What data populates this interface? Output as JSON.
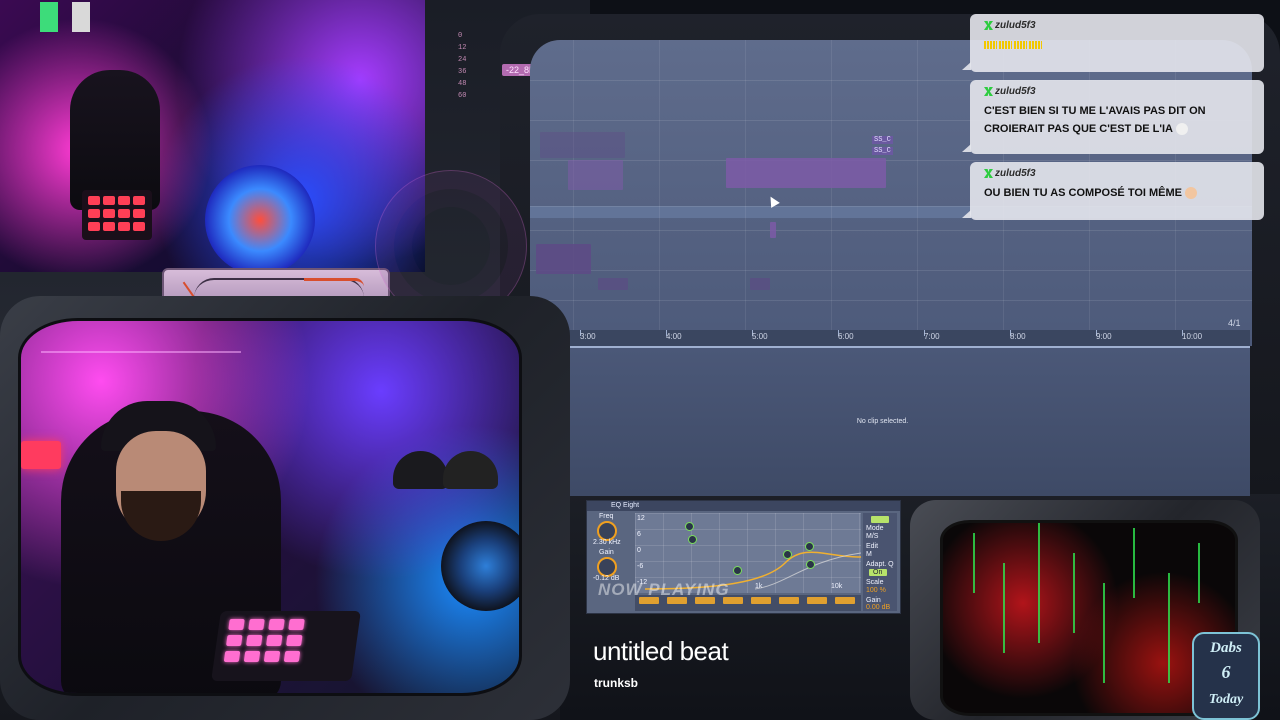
{
  "daw": {
    "loudness_badge": "-22_8LUFS",
    "meter_scale": [
      "0",
      "12",
      "24",
      "36",
      "48",
      "60"
    ],
    "clip_labels": [
      "SS_C",
      "SS_C"
    ],
    "timeline_ticks": [
      "3:00",
      "4:00",
      "5:00",
      "6:00",
      "7:00",
      "8:00",
      "9:00",
      "10:00"
    ],
    "position_label": "4/1",
    "detail_message": "No clip selected."
  },
  "chat": {
    "messages": [
      {
        "user": "zulud5f3",
        "text": ""
      },
      {
        "user": "zulud5f3",
        "text": "C'EST BIEN SI TU ME L'AVAIS PAS DIT ON CROIERAIT PAS QUE C'EST DE L'IA"
      },
      {
        "user": "zulud5f3",
        "text": "OU BIEN TU AS COMPOSÉ TOI MÊME"
      }
    ]
  },
  "eq": {
    "title": "EQ Eight",
    "freq_label": "Freq",
    "freq_value": "2.30 kHz",
    "gain_label": "Gain",
    "gain_value": "-0.12 dB",
    "db_scale": [
      "12",
      "6",
      "0",
      "-6",
      "-12"
    ],
    "mode_label": "Mode",
    "mode_value": "M/S",
    "edit_label": "Edit",
    "edit_value": "M",
    "adapt_label": "Adapt. Q",
    "adapt_value": "On",
    "scale_label": "Scale",
    "scale_value": "100 %",
    "out_gain_label": "Gain",
    "out_gain_value": "0.00 dB",
    "freq_axis": [
      "1k",
      "10k"
    ]
  },
  "now_playing": {
    "label": "NOW PLAYING",
    "title": "untitled beat",
    "artist": "trunksb"
  },
  "logo": {
    "line1": "Dabs",
    "line2": "6",
    "line3": "Today"
  },
  "colors": {
    "accent_purple": "#7d5ba7",
    "chat_badge_green": "#2ecc40",
    "eq_node_green": "#7ae05a",
    "eq_band_orange": "#e0a030"
  }
}
